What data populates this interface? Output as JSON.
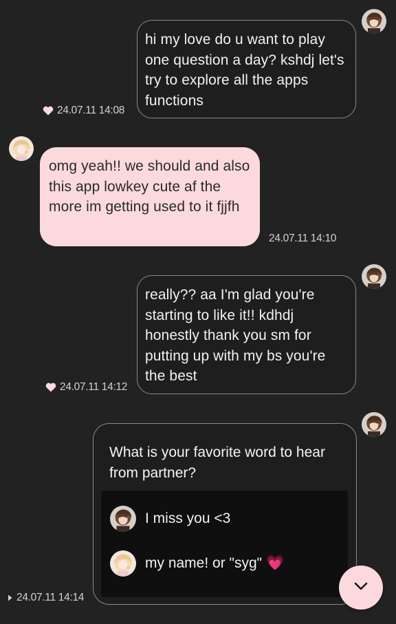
{
  "messages": [
    {
      "sender": "me",
      "text": "hi my love do u want to play one question a day? kshdj let's try to explore all the apps functions",
      "timestamp": "24.07.11 14:08",
      "reaction": "heart"
    },
    {
      "sender": "partner",
      "text": "omg yeah!! we should and also this app lowkey cute af the more im getting used to it fjjfh",
      "timestamp": "24.07.11 14:10"
    },
    {
      "sender": "me",
      "text": "really?? aa I'm glad you're starting to like it!! kdhdj honestly thank you sm for putting up with my bs you're the best",
      "timestamp": "24.07.11 14:12",
      "reaction": "heart"
    }
  ],
  "question_card": {
    "question": "What is your favorite word to hear from partner?",
    "answers": [
      {
        "author": "me",
        "text": "I miss you <3"
      },
      {
        "author": "partner",
        "text": "my name! or \"syg\" 💗"
      }
    ],
    "timestamp": "24.07.11 14:14",
    "status_icon": "sent-arrow-icon"
  },
  "scroll_button": {
    "icon": "chevron-down-icon"
  },
  "colors": {
    "background": "#222222",
    "incoming_bubble": "#fcd9dd",
    "outgoing_border": "#8a8a8a",
    "heart": "#fcd9dd"
  }
}
